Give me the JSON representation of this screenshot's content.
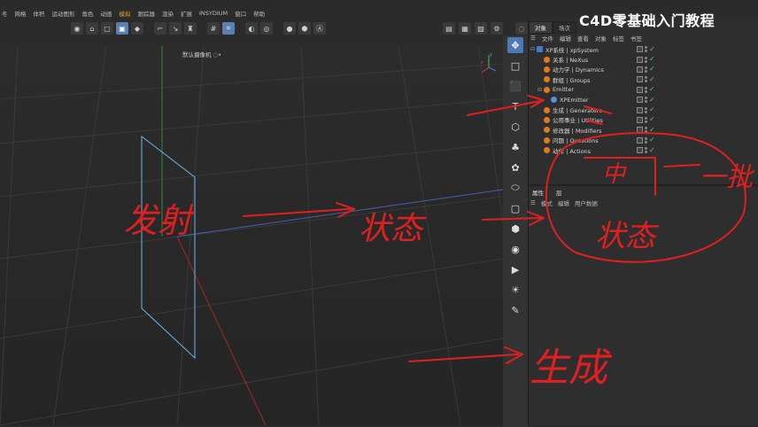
{
  "menubar": [
    "冬",
    "网格",
    "体积",
    "运动图形",
    "角色",
    "动画",
    "模拟",
    "跟踪器",
    "渲染",
    "扩展",
    "INSYDIUM",
    "窗口",
    "帮助"
  ],
  "menubar_highlight": "模拟",
  "viewport": {
    "menu": [
      "",
      ""
    ],
    "camera_label": "默认摄像机 ◌•"
  },
  "toolbar_icons": [
    "live-select-icon",
    "move-icon",
    "cube-select-icon",
    "model-mode-icon",
    "model-mode-icon",
    "line-icon",
    "axis-icon",
    "lock-icon",
    "grid-icon",
    "snap-icon",
    "enable-icon",
    "target-icon",
    "sphere-icon",
    "hex-icon",
    "a-icon"
  ],
  "panel": {
    "tabs": [
      "对象",
      "场次"
    ],
    "menu": [
      "文件",
      "编辑",
      "查看",
      "对象",
      "标签",
      "书签"
    ],
    "objects": [
      {
        "name": "XP系统 | xpSystem",
        "indent": 0,
        "icon": "sys",
        "expander": "⊟"
      },
      {
        "name": "关系 | NeXus",
        "indent": 1,
        "icon": "orange",
        "expander": ""
      },
      {
        "name": "动力学 | Dynamics",
        "indent": 1,
        "icon": "orange",
        "expander": ""
      },
      {
        "name": "群组 | Groups",
        "indent": 1,
        "icon": "orange",
        "expander": ""
      },
      {
        "name": "Emitter",
        "indent": 1,
        "icon": "orange",
        "expander": "⊟"
      },
      {
        "name": "XPEmitter",
        "indent": 2,
        "icon": "blue",
        "expander": ""
      },
      {
        "name": "生成 | Generators",
        "indent": 1,
        "icon": "orange",
        "expander": ""
      },
      {
        "name": "公用事业 | Utilities",
        "indent": 1,
        "icon": "orange",
        "expander": ""
      },
      {
        "name": "修改器 | Modifiers",
        "indent": 1,
        "icon": "orange",
        "expander": ""
      },
      {
        "name": "问题 | Questions",
        "indent": 1,
        "icon": "orange",
        "expander": ""
      },
      {
        "name": "动作 | Actions",
        "indent": 1,
        "icon": "orange",
        "expander": ""
      }
    ],
    "attr_tabs": [
      "属性",
      "层"
    ],
    "attr_menu": [
      "模式",
      "编辑",
      "用户数据"
    ]
  },
  "watermark": "C4D零基础入门教程",
  "annotations": {
    "emit": "发射",
    "state1": "状态",
    "gen": "生成",
    "state2": "状态",
    "mid": "中",
    "pace": "一批"
  },
  "colors": {
    "annotation": "#e02020",
    "accent": "#4e78b8",
    "check": "#5fd35f"
  }
}
